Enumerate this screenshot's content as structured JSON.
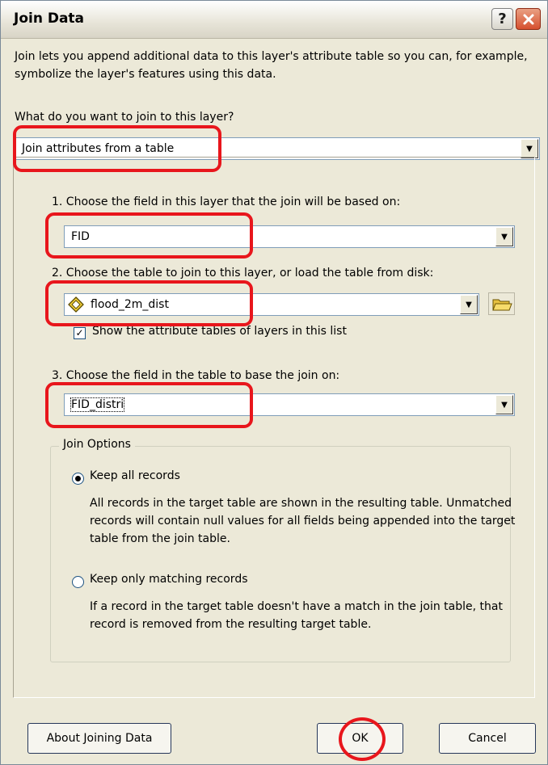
{
  "window": {
    "title": "Join Data",
    "help_label": "?"
  },
  "intro": "Join lets you append additional data to this layer's attribute table so you can, for example, symbolize the layer's features using this data.",
  "question": "What do you want to join to this layer?",
  "join_type": {
    "value": "Join attributes from a table"
  },
  "step1": {
    "label": "1.  Choose the field in this layer that the join will be based on:",
    "value": "FID"
  },
  "step2": {
    "label": "2.  Choose the table to join to this layer, or load the table from disk:",
    "value": "flood_2m_dist",
    "show_attr_label": "Show the attribute tables of layers in this list",
    "show_attr_checked": true
  },
  "step3": {
    "label": "3.  Choose the field in the table to base the join on:",
    "value": "FID_distri"
  },
  "join_options": {
    "title": "Join Options",
    "keep_all": {
      "label": "Keep all records",
      "selected": true,
      "description": "All records in the target table are shown in the resulting table. Unmatched records will contain null values for all fields being appended into the target table from the join table."
    },
    "keep_matching": {
      "label": "Keep only matching records",
      "selected": false,
      "description": "If a record in the target table doesn't have a match in the join table, that record is removed from the resulting target table."
    }
  },
  "buttons": {
    "about": "About Joining Data",
    "ok": "OK",
    "cancel": "Cancel"
  },
  "annotation_color": "#e8161c"
}
